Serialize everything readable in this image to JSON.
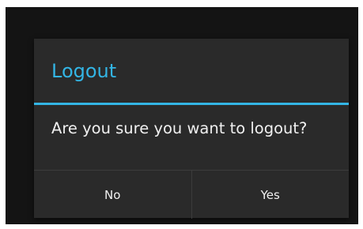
{
  "dialog": {
    "title": "Logout",
    "message": "Are you sure you want to logout?",
    "buttons": {
      "negative": "No",
      "positive": "Yes"
    }
  },
  "colors": {
    "accent": "#33b5e5",
    "dialog_background": "#2a2a2a",
    "screen_background": "#141414",
    "text": "#f0f0f0"
  }
}
